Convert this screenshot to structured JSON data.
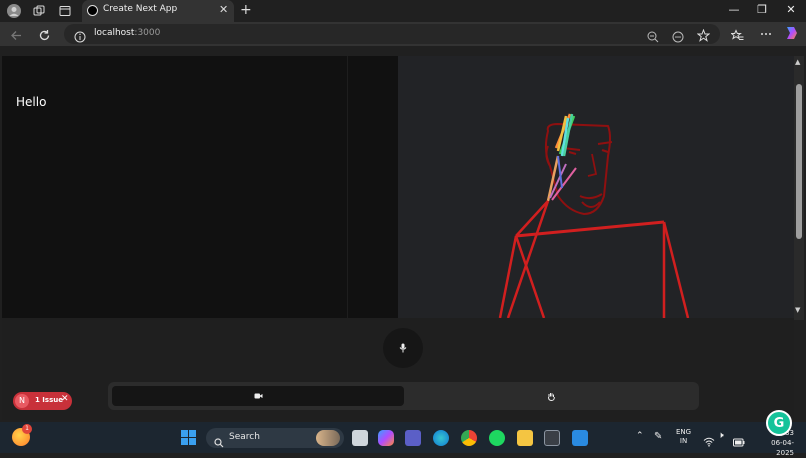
{
  "browser": {
    "tab_title": "Create Next App",
    "tab_close": "✕",
    "new_tab": "+",
    "url_host": "localhost",
    "url_port": ":3000",
    "window_minimize": "—",
    "window_restore": "❐",
    "window_close": "✕"
  },
  "page": {
    "left_heading": "Hello",
    "issue_badge": {
      "letter": "N",
      "text": "1 Issue",
      "close": "✕"
    }
  },
  "taskbar": {
    "search_label": "Search",
    "lang_line1": "ENG",
    "lang_line2": "IN",
    "time": "…33",
    "date": "06-04-2025",
    "weather_badge": "1"
  },
  "grammarly_label": "G",
  "colors": {
    "accent_red": "#d11f1f",
    "badge_red": "#c8313a",
    "taskbar": "#1c2630"
  }
}
